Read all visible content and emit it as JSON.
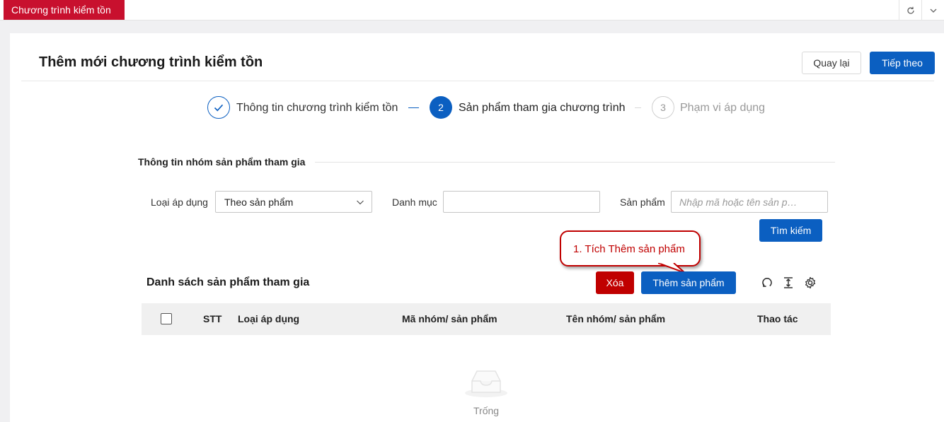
{
  "topbar": {
    "tab_label": "Chương trình kiểm tồn"
  },
  "header": {
    "title": "Thêm mới chương trình kiểm tồn",
    "back_label": "Quay lại",
    "next_label": "Tiếp theo"
  },
  "steps": [
    {
      "number": "✓",
      "label": "Thông tin chương trình kiểm tồn",
      "state": "done"
    },
    {
      "number": "2",
      "label": "Sản phẩm tham gia chương trình",
      "state": "active"
    },
    {
      "number": "3",
      "label": "Phạm vi áp dụng",
      "state": "pending"
    }
  ],
  "filter": {
    "section_title": "Thông tin nhóm sản phẩm tham gia",
    "type_label": "Loại áp dụng",
    "type_value": "Theo sản phẩm",
    "category_label": "Danh mục",
    "category_value": "",
    "product_label": "Sản phẩm",
    "product_placeholder": "Nhập mã hoặc tên sản p…",
    "search_label": "Tìm kiếm"
  },
  "callout": {
    "text": "1. Tích Thêm sản phẩm"
  },
  "list": {
    "title": "Danh sách sản phẩm tham gia",
    "delete_label": "Xóa",
    "add_label": "Thêm sản phẩm",
    "columns": [
      "STT",
      "Loại áp dụng",
      "Mã nhóm/ sản phẩm",
      "Tên nhóm/ sản phẩm",
      "Thao tác"
    ],
    "empty_text": "Trống"
  },
  "colors": {
    "primary": "#0b5fc1",
    "danger": "#c00000",
    "tab": "#c8102e"
  }
}
